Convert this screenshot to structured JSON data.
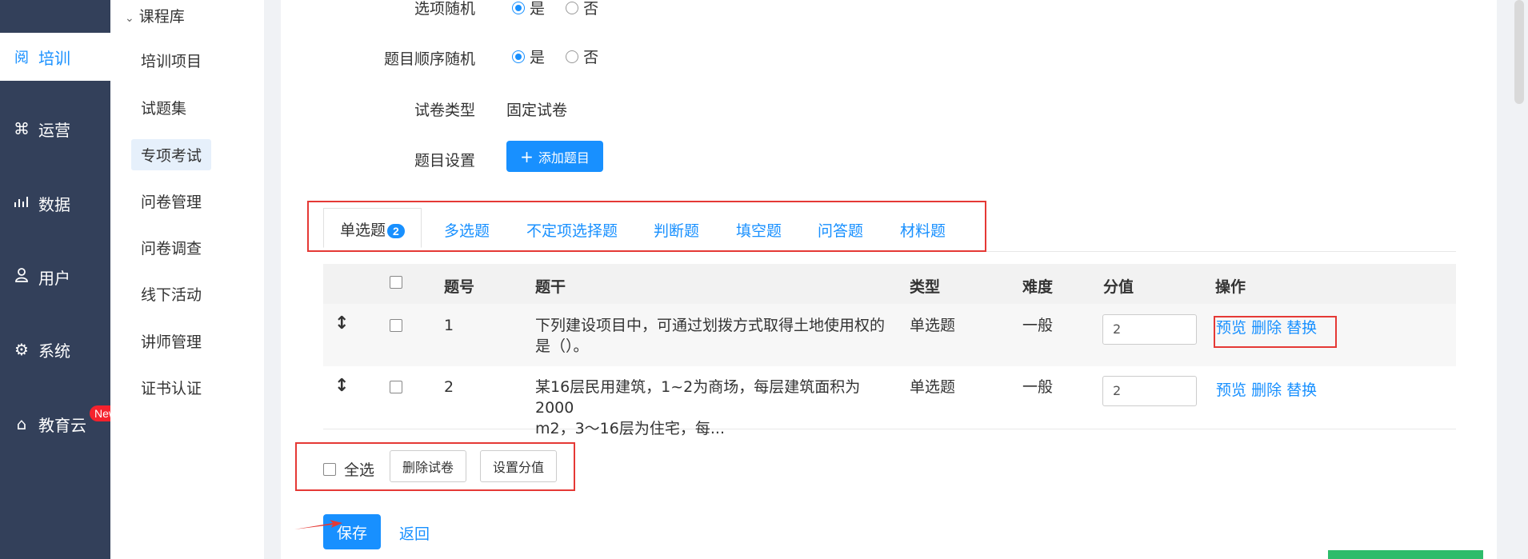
{
  "sidebar": {
    "items": [
      {
        "icon": "training-icon",
        "glyph": "阅",
        "label": "培训",
        "active": true
      },
      {
        "icon": "operation-icon",
        "glyph": "⌘",
        "label": "运营"
      },
      {
        "icon": "chart-icon",
        "glyph": "📶",
        "label": "数据"
      },
      {
        "icon": "user-icon",
        "glyph": "👤",
        "label": "用户"
      },
      {
        "icon": "gear-icon",
        "glyph": "⚙",
        "label": "系统"
      },
      {
        "icon": "cloud-home-icon",
        "glyph": "⌂",
        "label": "教育云"
      }
    ],
    "new_badge": "New"
  },
  "submenu": {
    "header": "课程库",
    "items": [
      "培训项目",
      "试题集",
      "专项考试",
      "问卷管理",
      "问卷调查",
      "线下活动",
      "讲师管理",
      "证书认证"
    ],
    "active": "专项考试"
  },
  "form": {
    "option_random_label": "选项随机",
    "question_random_label": "题目顺序随机",
    "yes": "是",
    "no": "否",
    "paper_type_label": "试卷类型",
    "paper_type_value": "固定试卷",
    "question_setting_label": "题目设置",
    "add_question_button": "添加题目"
  },
  "tabs": {
    "items": [
      "单选题",
      "多选题",
      "不定项选择题",
      "判断题",
      "填空题",
      "问答题",
      "材料题"
    ],
    "active_count": "2"
  },
  "table": {
    "headers": {
      "no": "题号",
      "stem": "题干",
      "type": "类型",
      "difficulty": "难度",
      "score": "分值",
      "actions": "操作"
    },
    "rows": [
      {
        "no": "1",
        "stem_line1": "下列建设项目中，可通过划拨方式取得土地使用权的",
        "stem_line2": "是（）。",
        "type": "单选题",
        "difficulty": "一般",
        "score": "2"
      },
      {
        "no": "2",
        "stem_line1": "某16层民用建筑，1~2为商场，每层建筑面积为2000",
        "stem_line2": "m2，3～16层为住宅，每...",
        "type": "单选题",
        "difficulty": "一般",
        "score": "2"
      }
    ],
    "action_preview": "预览",
    "action_delete": "删除",
    "action_replace": "替换"
  },
  "bulk": {
    "select_all": "全选",
    "delete_button": "删除试卷",
    "set_score_button": "设置分值"
  },
  "footer": {
    "save": "保存",
    "back": "返回"
  },
  "colors": {
    "accent": "#1890ff",
    "sidebar": "#33405a",
    "highlight": "#e53935"
  }
}
